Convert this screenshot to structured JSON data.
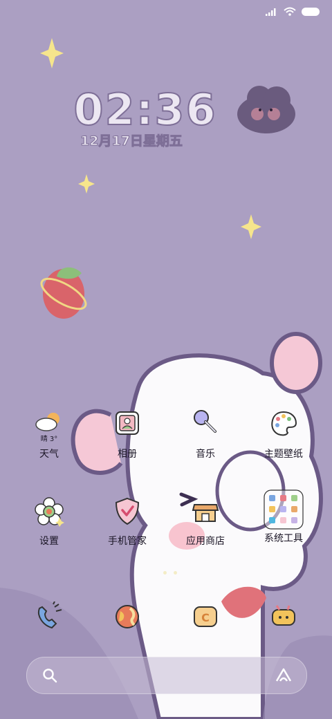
{
  "status_bar": {
    "signal_icon": "signal-icon",
    "wifi_icon": "wifi-icon",
    "battery_icon": "battery-icon"
  },
  "clock": {
    "time": "02:36",
    "date": "12月17日星期五"
  },
  "apps_row1": [
    {
      "label": "天气",
      "sub": "晴 3°",
      "icon": "weather-icon"
    },
    {
      "label": "相册",
      "icon": "gallery-icon"
    },
    {
      "label": "音乐",
      "icon": "music-icon"
    },
    {
      "label": "主题壁纸",
      "icon": "theme-icon"
    }
  ],
  "apps_row2": [
    {
      "label": "设置",
      "icon": "settings-icon"
    },
    {
      "label": "手机管家",
      "icon": "security-icon"
    },
    {
      "label": "应用商店",
      "icon": "app-store-icon"
    },
    {
      "label": "系统工具",
      "icon": "folder-icon"
    }
  ],
  "dock": [
    {
      "icon": "phone-icon"
    },
    {
      "icon": "browser-icon"
    },
    {
      "icon": "camera-icon"
    },
    {
      "icon": "messages-icon"
    }
  ],
  "search": {
    "search_icon": "search-icon",
    "assistant_icon": "assistant-icon"
  },
  "page_indicator": {
    "pages": 2
  },
  "colors": {
    "background": "#ab9fc2",
    "clock_fill": "#ece7f2",
    "clock_outline": "#7e6f97"
  }
}
